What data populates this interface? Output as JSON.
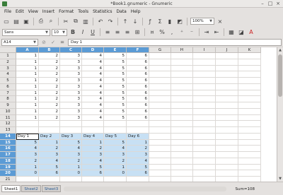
{
  "window": {
    "title": "*Book1.gnumeric - Gnumeric"
  },
  "menu": [
    "File",
    "Edit",
    "View",
    "Insert",
    "Format",
    "Tools",
    "Statistics",
    "Data",
    "Help"
  ],
  "toolbar": {
    "zoom": "100%",
    "icons": [
      "new-icon",
      "open-icon",
      "save-icon",
      "print-icon",
      "print-preview-icon",
      "cut-icon",
      "copy-icon",
      "paste-icon",
      "undo-icon",
      "redo-icon",
      "sort-ascending-icon",
      "sort-descending-icon",
      "function-icon",
      "sum-icon",
      "chart-icon",
      "image-icon"
    ]
  },
  "format_bar": {
    "font": "Sans",
    "size": "10",
    "icons": [
      "bold-icon",
      "italic-icon",
      "underline-icon",
      "align-left-icon",
      "align-center-icon",
      "align-right-icon",
      "merge-icon",
      "currency-icon",
      "percent-icon",
      "thousands-icon",
      "decimal-increase-icon",
      "decimal-decrease-icon",
      "indent-icon",
      "outdent-icon",
      "borders-icon",
      "background-color-icon",
      "font-color-icon"
    ]
  },
  "formula_bar": {
    "cell_ref": "A14",
    "content": "Day 1"
  },
  "columns": [
    "A",
    "B",
    "C",
    "D",
    "E",
    "F",
    "G",
    "H",
    "I",
    "J",
    "K"
  ],
  "selected_columns": [
    "A",
    "B",
    "C",
    "D",
    "E",
    "F"
  ],
  "rows": [
    "1",
    "2",
    "3",
    "4",
    "5",
    "6",
    "7",
    "8",
    "9",
    "10",
    "11",
    "12",
    "13",
    "14",
    "15",
    "16",
    "17",
    "18",
    "19",
    "20",
    "21"
  ],
  "selected_rows": [
    "14",
    "15",
    "16",
    "17",
    "18",
    "19",
    "20"
  ],
  "cells": {
    "r1": [
      "1",
      "2",
      "3",
      "4",
      "5",
      "6"
    ],
    "r2": [
      "1",
      "2",
      "3",
      "4",
      "5",
      "6"
    ],
    "r3": [
      "1",
      "2",
      "3",
      "4",
      "5",
      "6"
    ],
    "r4": [
      "1",
      "2",
      "3",
      "4",
      "5",
      "6"
    ],
    "r5": [
      "1",
      "2",
      "3",
      "4",
      "5",
      "6"
    ],
    "r6": [
      "1",
      "2",
      "3",
      "4",
      "5",
      "6"
    ],
    "r7": [
      "1",
      "2",
      "3",
      "4",
      "5",
      "6"
    ],
    "r8": [
      "1",
      "2",
      "3",
      "4",
      "5",
      "6"
    ],
    "r9": [
      "1",
      "2",
      "3",
      "4",
      "5",
      "6"
    ],
    "r10": [
      "1",
      "2",
      "3",
      "4",
      "5",
      "6"
    ],
    "r11": [
      "1",
      "2",
      "3",
      "4",
      "5",
      "6"
    ],
    "r14": [
      "Day 1",
      "Day 2",
      "Day 3",
      "Day 4",
      "Day 5",
      "Day 6"
    ],
    "r15": [
      "5",
      "1",
      "5",
      "1",
      "5",
      "1"
    ],
    "r16": [
      "4",
      "2",
      "4",
      "2",
      "4",
      "2"
    ],
    "r17": [
      "3",
      "3",
      "3",
      "3",
      "3",
      "3"
    ],
    "r18": [
      "2",
      "4",
      "2",
      "4",
      "2",
      "4"
    ],
    "r19": [
      "1",
      "5",
      "1",
      "5",
      "1",
      "5"
    ],
    "r20": [
      "0",
      "6",
      "0",
      "6",
      "0",
      "6"
    ]
  },
  "sheets": [
    "Sheet1",
    "Sheet2",
    "Sheet3"
  ],
  "active_sheet": "Sheet1",
  "status": {
    "sum": "Sum=108"
  },
  "colors": {
    "selection": "#c7e0f4",
    "header_selected": "#5b9bd5"
  }
}
